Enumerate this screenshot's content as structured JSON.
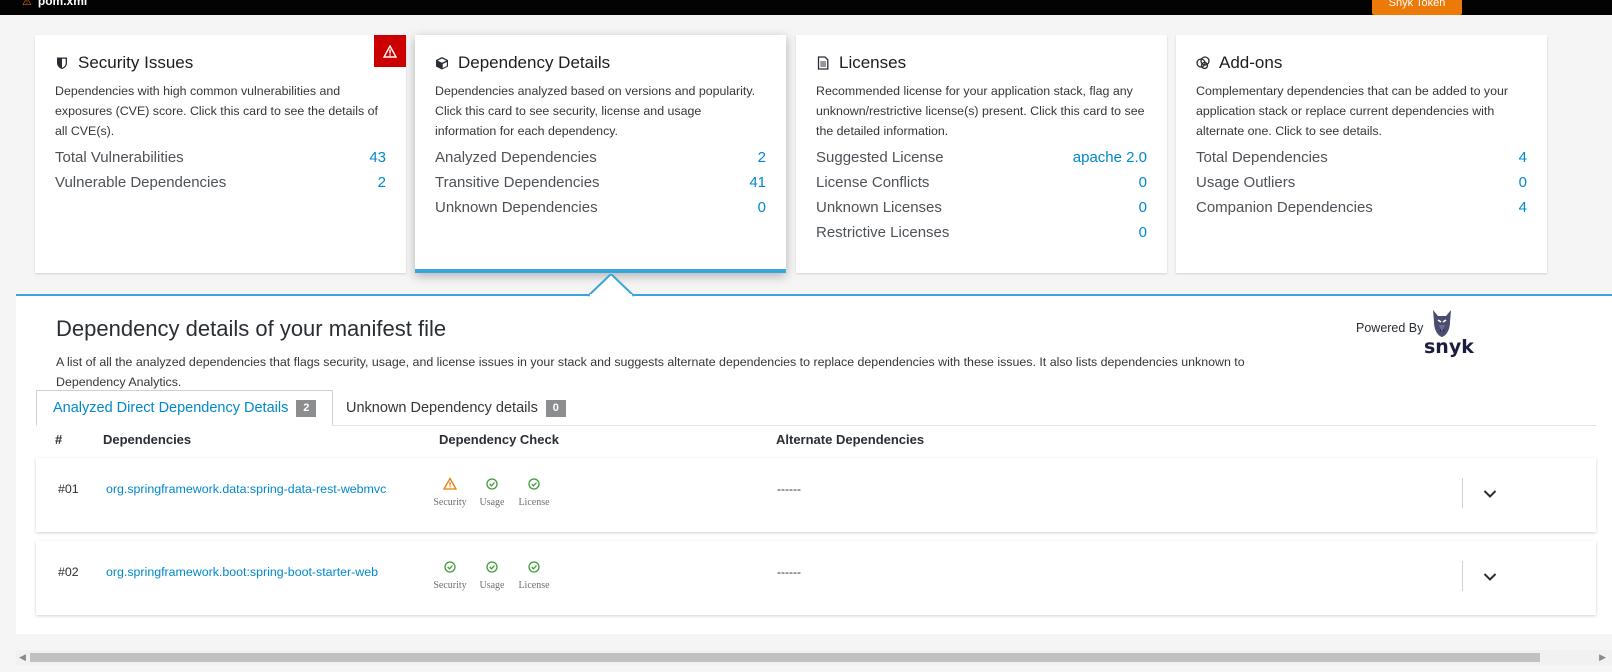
{
  "topbar": {
    "file_name": "pom.xml",
    "token_label": "Snyk Token"
  },
  "cards": [
    {
      "title": "Security Issues",
      "icon": "shield-icon",
      "description": "Dependencies with high common vulnerabilities and exposures (CVE) score. Click this card to see the details of all CVE(s).",
      "stats": [
        {
          "label": "Total Vulnerabilities",
          "value": "43"
        },
        {
          "label": "Vulnerable Dependencies",
          "value": "2"
        }
      ]
    },
    {
      "title": "Dependency Details",
      "icon": "cube-icon",
      "description": "Dependencies analyzed based on versions and popularity. Click this card to see security, license and usage information for each dependency.",
      "stats": [
        {
          "label": "Analyzed Dependencies",
          "value": "2"
        },
        {
          "label": "Transitive Dependencies",
          "value": "41"
        },
        {
          "label": "Unknown Dependencies",
          "value": "0"
        }
      ]
    },
    {
      "title": "Licenses",
      "icon": "file-text-icon",
      "description": "Recommended license for your application stack, flag any unknown/restrictive license(s) present. Click this card to see the detailed information.",
      "stats": [
        {
          "label": "Suggested License",
          "value": "apache 2.0"
        },
        {
          "label": "License Conflicts",
          "value": "0"
        },
        {
          "label": "Unknown Licenses",
          "value": "0"
        },
        {
          "label": "Restrictive Licenses",
          "value": "0"
        }
      ]
    },
    {
      "title": "Add-ons",
      "icon": "addons-icon",
      "description": "Complementary dependencies that can be added to your application stack or replace current dependencies with alternate one. Click to see details.",
      "stats": [
        {
          "label": "Total Dependencies",
          "value": "4"
        },
        {
          "label": "Usage Outliers",
          "value": "0"
        },
        {
          "label": "Companion Dependencies",
          "value": "4"
        }
      ]
    }
  ],
  "details": {
    "title": "Dependency details of your manifest file",
    "intro": "A list of all the analyzed dependencies that flags security, usage, and license issues in your stack and suggests alternate dependencies to replace dependencies with these issues. It also lists dependencies unknown to Dependency Analytics.",
    "powered_by": "Powered By",
    "snyk_word": "snyk",
    "tabs": [
      {
        "label": "Analyzed Direct Dependency Details",
        "count": "2"
      },
      {
        "label": "Unknown Dependency details",
        "count": "0"
      }
    ],
    "columns": {
      "num": "#",
      "deps": "Dependencies",
      "check": "Dependency Check",
      "alt": "Alternate Dependencies"
    },
    "check_labels": {
      "security": "Security",
      "usage": "Usage",
      "license": "License"
    },
    "rows": [
      {
        "num": "#01",
        "name": "org.springframework.data:spring-data-rest-webmvc",
        "security": "warning",
        "usage": "ok",
        "license": "ok",
        "alternate": "------"
      },
      {
        "num": "#02",
        "name": "org.springframework.boot:spring-boot-starter-web",
        "security": "ok",
        "usage": "ok",
        "license": "ok",
        "alternate": "------"
      }
    ]
  },
  "colors": {
    "accent": "#0088ce",
    "active_border": "#39a5dc",
    "danger": "#cc0000",
    "warning": "#ec7a08",
    "ok": "#3f9c35"
  }
}
